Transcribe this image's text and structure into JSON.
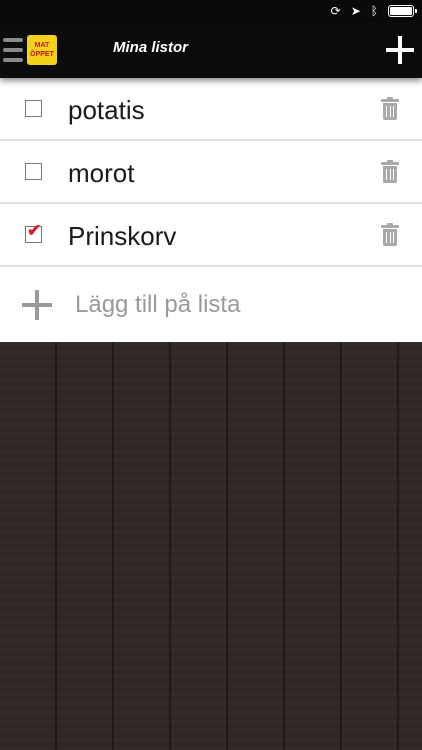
{
  "status_bar": {
    "icons": [
      "orientation-lock-icon",
      "location-arrow-icon",
      "bluetooth-icon",
      "battery-icon"
    ],
    "battery_level": 1.0
  },
  "header": {
    "title": "Mina listor",
    "logo": {
      "line1": "MAT",
      "line2": "ÖPPET"
    },
    "add_icon": "plus-icon",
    "menu_icon": "hamburger-icon"
  },
  "items": [
    {
      "label": "potatis",
      "checked": false
    },
    {
      "label": "morot",
      "checked": false
    },
    {
      "label": "Prinskorv",
      "checked": true
    }
  ],
  "add_row": {
    "label": "Lägg till på lista"
  },
  "colors": {
    "navbar": "#0c0c0c",
    "logo_bg": "#f3d21a",
    "logo_text": "#c4141b",
    "check": "#d81e2a",
    "background": "#2e2724"
  }
}
